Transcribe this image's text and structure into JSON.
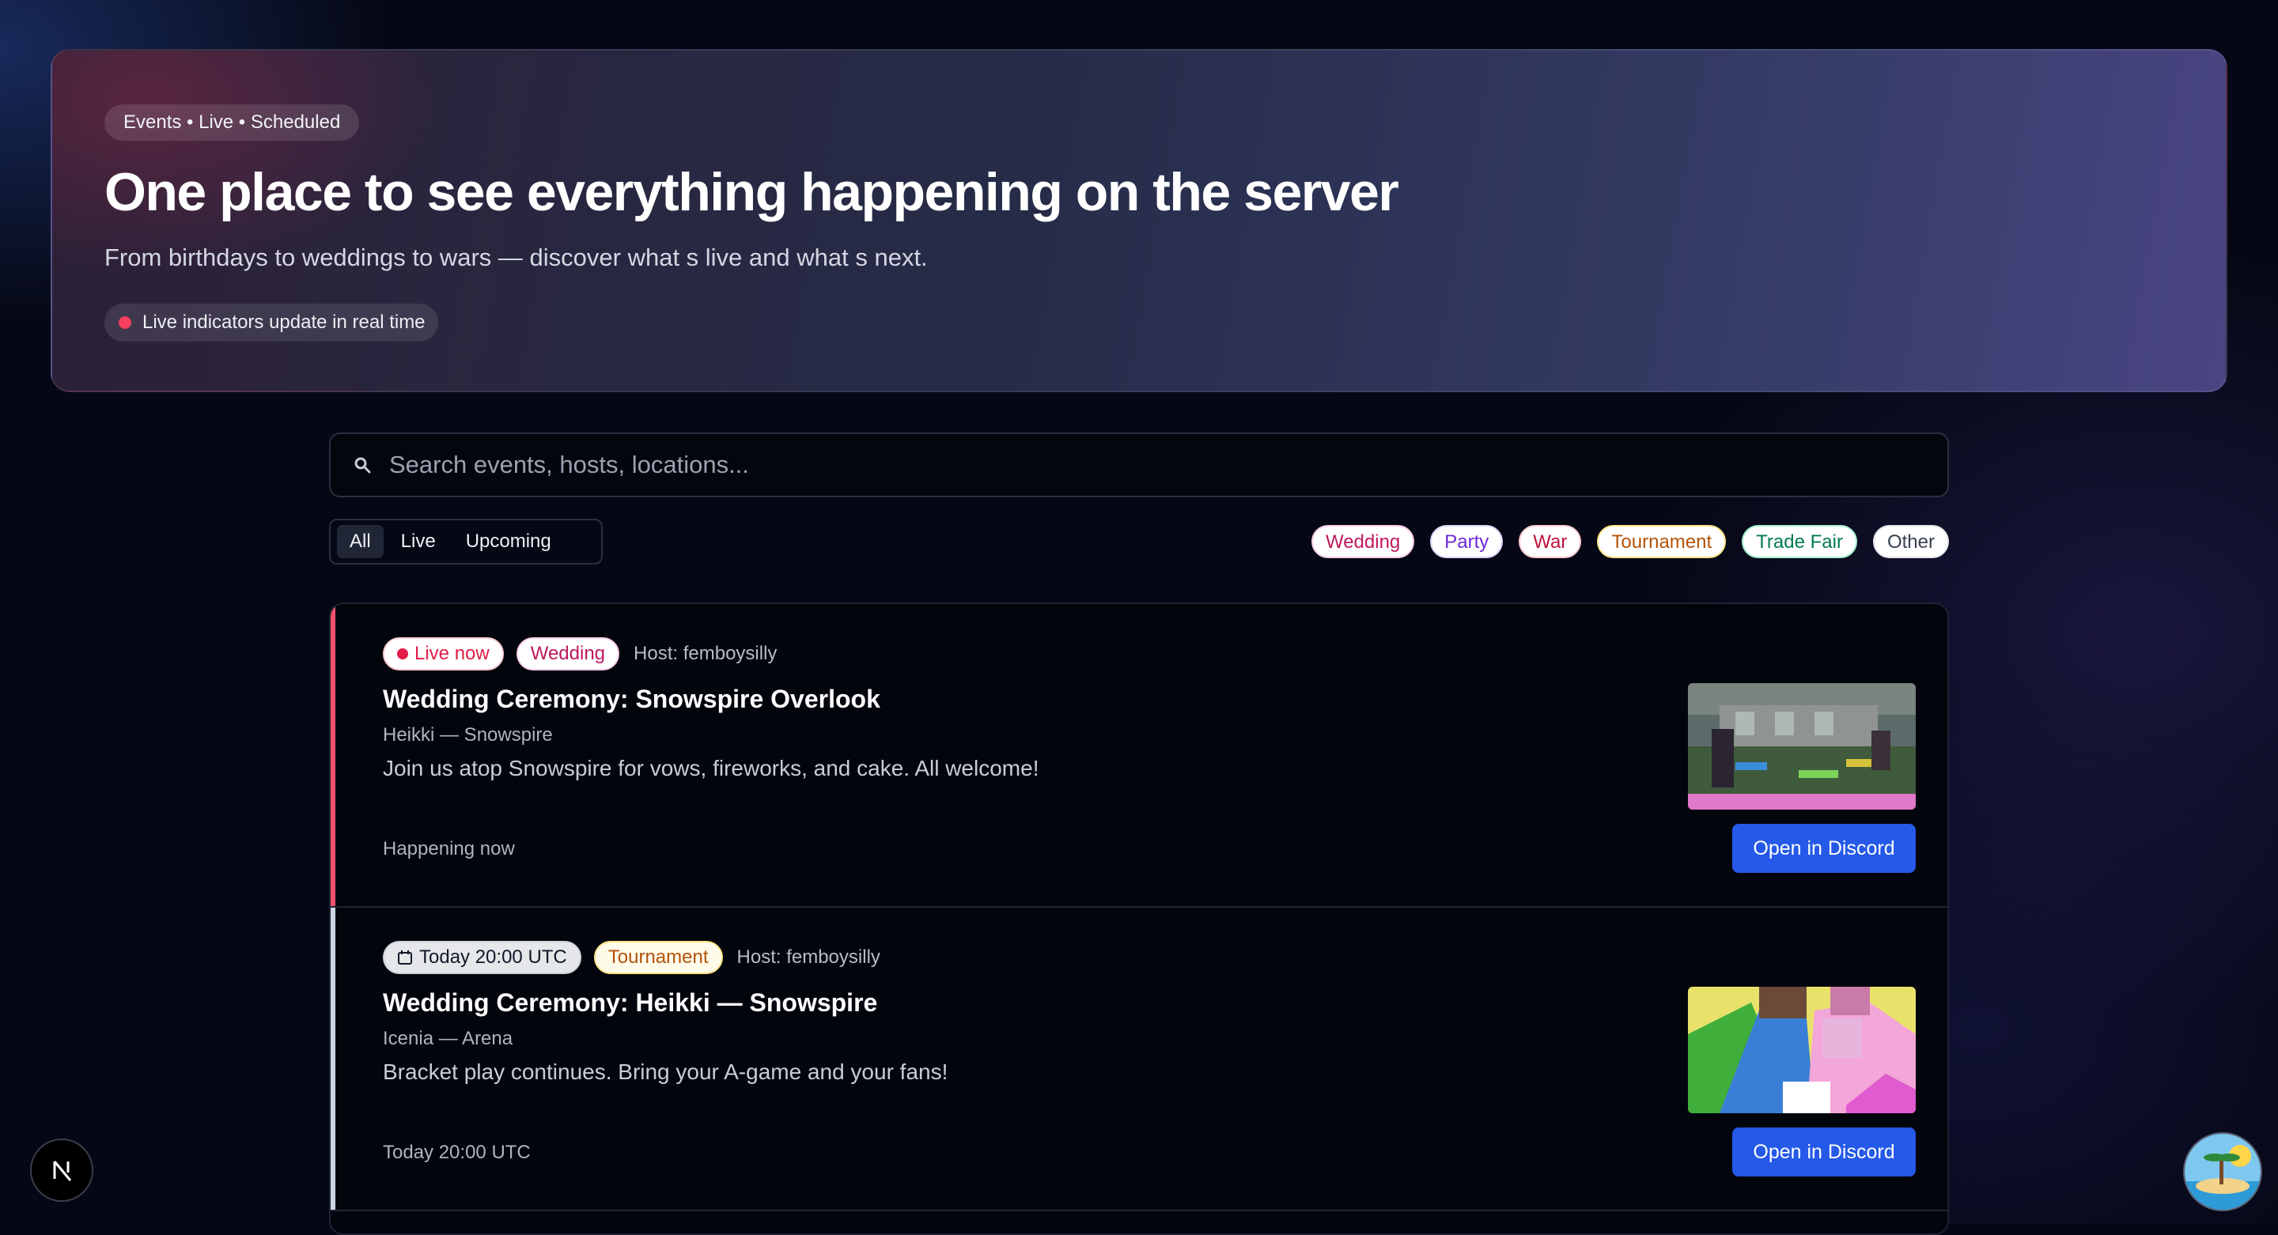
{
  "hero": {
    "tag": "Events • Live • Scheduled",
    "title": "One place to see everything happening on the server",
    "subtitle": "From birthdays to weddings to wars — discover what s live and what s next.",
    "live_note": "Live indicators update in real time"
  },
  "search": {
    "placeholder": "Search events, hosts, locations...",
    "icon": "search-icon"
  },
  "segments": [
    "All",
    "Live",
    "Upcoming"
  ],
  "active_segment": "All",
  "categories": [
    {
      "label": "Wedding",
      "color": "#be185d",
      "border": "#fbcfe8"
    },
    {
      "label": "Party",
      "color": "#6d28d9",
      "border": "#ddd6fe"
    },
    {
      "label": "War",
      "color": "#be123c",
      "border": "#fecdd3"
    },
    {
      "label": "Tournament",
      "color": "#b45309",
      "border": "#fde68a"
    },
    {
      "label": "Trade Fair",
      "color": "#047857",
      "border": "#a7f3d0"
    },
    {
      "label": "Other",
      "color": "#374151",
      "border": "#e5e7eb"
    }
  ],
  "events": [
    {
      "status": "Live now",
      "category": "Wedding",
      "host": "Host: femboysilly",
      "title": "Wedding Ceremony: Snowspire Overlook",
      "location": "Heikki — Snowspire",
      "description": "Join us atop Snowspire for vows, fireworks, and cake. All welcome!",
      "when": "Happening now",
      "button": "Open in Discord",
      "accent": "#f0506e"
    },
    {
      "status": "Today 20:00 UTC",
      "category": "Tournament",
      "host": "Host: femboysilly",
      "title": "Wedding Ceremony: Heikki — Snowspire",
      "location": "Icenia — Arena",
      "description": "Bracket play continues. Bring your A-game and your fans!",
      "when": "Today 20:00 UTC",
      "button": "Open in Discord",
      "accent": "#cbd5e1"
    }
  ],
  "corner_badge": "N"
}
